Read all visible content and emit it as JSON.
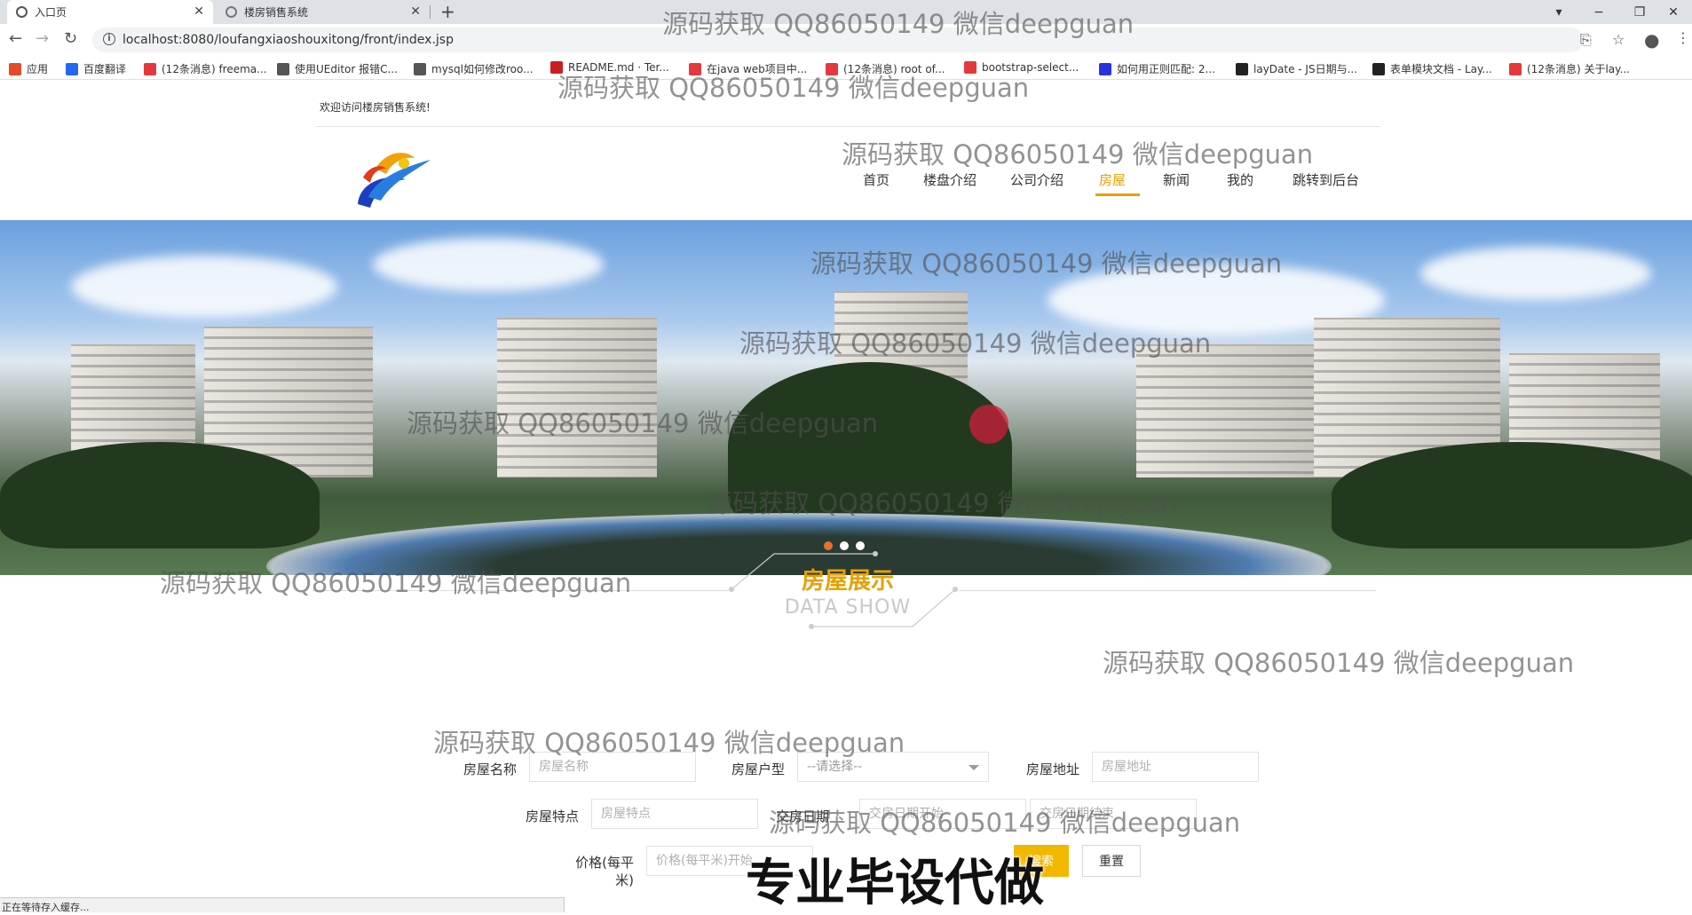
{
  "browser": {
    "tabs": [
      {
        "label": "入口页",
        "active": true
      },
      {
        "label": "楼房销售系统",
        "active": false
      }
    ],
    "url": "localhost:8080/loufangxiaoshouxitong/front/index.jsp",
    "bookmarks": [
      {
        "label": "应用",
        "icon": "apps-icon",
        "color": "#e34c26"
      },
      {
        "label": "百度翻译",
        "icon": "baidu-translate-icon",
        "color": "#2468f2"
      },
      {
        "label": "(12条消息) freema...",
        "icon": "csdn-icon",
        "color": "#e4393c"
      },
      {
        "label": "使用UEditor 报错C...",
        "icon": "ueditor-icon",
        "color": "#555555"
      },
      {
        "label": "mysql如何修改roo...",
        "icon": "ueditor-icon",
        "color": "#555555"
      },
      {
        "label": "README.md · Ter...",
        "icon": "gitee-icon",
        "color": "#c71d23"
      },
      {
        "label": "在java web项目中...",
        "icon": "csdn-icon",
        "color": "#e4393c"
      },
      {
        "label": "(12条消息) root of...",
        "icon": "csdn-icon",
        "color": "#e4393c"
      },
      {
        "label": "bootstrap-select...",
        "icon": "cnblogs-icon",
        "color": "#e4393c"
      },
      {
        "label": "如何用正则匹配: 2...",
        "icon": "baidu-icon",
        "color": "#2932e1"
      },
      {
        "label": "layDate - JS日期与...",
        "icon": "layui-icon",
        "color": "#222222"
      },
      {
        "label": "表单模块文档 - Lay...",
        "icon": "layui-icon",
        "color": "#222222"
      },
      {
        "label": "(12条消息) 关于lay...",
        "icon": "csdn-icon",
        "color": "#e4393c"
      }
    ],
    "status": "正在等待存入缓存..."
  },
  "site": {
    "welcome": "欢迎访问楼房销售系统!",
    "nav": [
      {
        "label": "首页",
        "active": false
      },
      {
        "label": "楼盘介绍",
        "active": false
      },
      {
        "label": "公司介绍",
        "active": false
      },
      {
        "label": "房屋",
        "active": true
      },
      {
        "label": "新闻",
        "active": false
      },
      {
        "label": "我的",
        "active": false
      },
      {
        "label": "跳转到后台",
        "active": false
      }
    ],
    "accent": "#e8a000",
    "carousel_active": 0,
    "section_title": "房屋展示",
    "section_sub": "DATA SHOW"
  },
  "search": {
    "name_label": "房屋名称",
    "name_placeholder": "房屋名称",
    "type_label": "房屋户型",
    "type_value": "--请选择--",
    "address_label": "房屋地址",
    "address_placeholder": "房屋地址",
    "feature_label": "房屋特点",
    "feature_placeholder": "房屋特点",
    "date_label": "交房日期",
    "date_start_placeholder": "交房日期开始",
    "date_end_placeholder": "交房日期结束",
    "price_label": "价格(每平米)",
    "price_placeholder": "价格(每平米)开始",
    "search_button": "搜索",
    "reset_button": "重置"
  },
  "overlay": {
    "watermark": "源码获取 QQ86050149 微信deepguan",
    "promo": "专业毕设代做"
  }
}
